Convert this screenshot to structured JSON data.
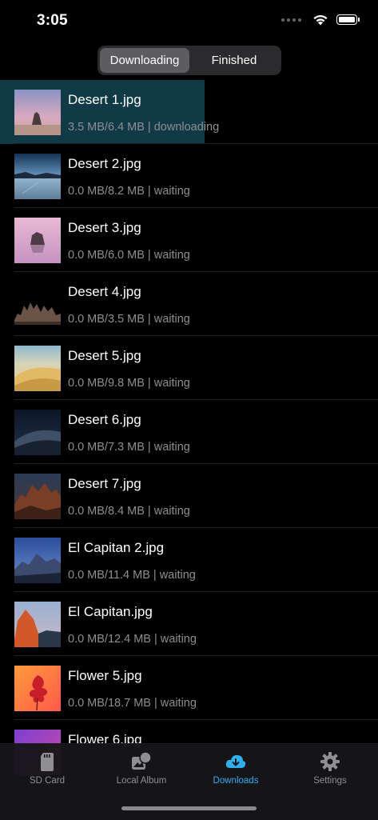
{
  "status_bar": {
    "time": "3:05",
    "icons": [
      "signal-dots-icon",
      "wifi-icon",
      "battery-icon"
    ]
  },
  "segments": [
    {
      "label": "Downloading",
      "active": true
    },
    {
      "label": "Finished",
      "active": false
    }
  ],
  "colors": {
    "accent": "#2eaff0",
    "progress_fill": "#0f3a46",
    "background": "#000000",
    "secondary_text": "#8e8e93"
  },
  "downloads": [
    {
      "name": "Desert 1.jpg",
      "status": "3.5 MB/6.4 MB | downloading",
      "progress": 0.546,
      "thumb": "desert-dusk-rock"
    },
    {
      "name": "Desert 2.jpg",
      "status": "0.0 MB/8.2 MB | waiting",
      "progress": 0,
      "thumb": "desert-blue-lake"
    },
    {
      "name": "Desert 3.jpg",
      "status": "0.0 MB/6.0 MB | waiting",
      "progress": 0,
      "thumb": "desert-pink-rock"
    },
    {
      "name": "Desert 4.jpg",
      "status": "0.0 MB/3.5 MB | waiting",
      "progress": 0,
      "thumb": "desert-dark-towers"
    },
    {
      "name": "Desert 5.jpg",
      "status": "0.0 MB/9.8 MB | waiting",
      "progress": 0,
      "thumb": "desert-dunes-day"
    },
    {
      "name": "Desert 6.jpg",
      "status": "0.0 MB/7.3 MB | waiting",
      "progress": 0,
      "thumb": "desert-dunes-night"
    },
    {
      "name": "Desert 7.jpg",
      "status": "0.0 MB/8.4 MB | waiting",
      "progress": 0,
      "thumb": "desert-red-rocks"
    },
    {
      "name": "El Capitan 2.jpg",
      "status": "0.0 MB/11.4 MB | waiting",
      "progress": 0,
      "thumb": "el-capitan-blue"
    },
    {
      "name": "El Capitan.jpg",
      "status": "0.0 MB/12.4 MB | waiting",
      "progress": 0,
      "thumb": "el-capitan-sunset"
    },
    {
      "name": "Flower 5.jpg",
      "status": "0.0 MB/18.7 MB | waiting",
      "progress": 0,
      "thumb": "flower-red"
    },
    {
      "name": "Flower 6.jpg",
      "status": "",
      "progress": 0,
      "thumb": "flower-purple"
    }
  ],
  "tabs": [
    {
      "label": "SD Card",
      "icon": "sd-card-icon",
      "active": false
    },
    {
      "label": "Local Album",
      "icon": "photo-album-icon",
      "active": false
    },
    {
      "label": "Downloads",
      "icon": "cloud-download-icon",
      "active": true
    },
    {
      "label": "Settings",
      "icon": "gear-icon",
      "active": false
    }
  ]
}
